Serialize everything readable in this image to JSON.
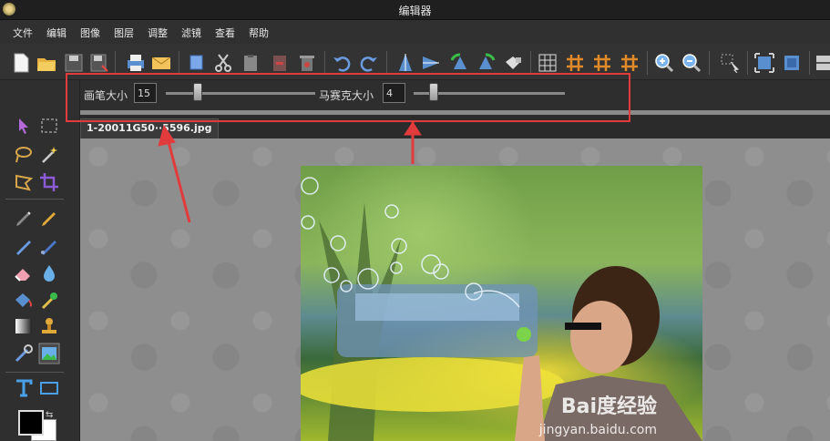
{
  "window": {
    "title": "编辑器"
  },
  "menu": [
    "文件",
    "编辑",
    "图像",
    "图层",
    "调整",
    "滤镜",
    "查看",
    "帮助"
  ],
  "toolbar_icons": [
    "new-file-icon",
    "open-folder-icon",
    "save-icon",
    "save-as-icon",
    "print-icon",
    "email-icon",
    "copy-icon",
    "cut-icon",
    "paste-icon",
    "delete-icon",
    "trash-icon",
    "undo-icon",
    "redo-icon",
    "flip-vertical-icon",
    "flip-horizontal-icon",
    "rotate-left-icon",
    "rotate-right-icon",
    "bucket-icon",
    "grid-icon",
    "hash-icon-1",
    "hash-icon-2",
    "hash-icon-3",
    "zoom-in-icon",
    "zoom-out-icon",
    "pointer-icon",
    "crop-fit-icon",
    "crop-full-icon",
    "panel-icon"
  ],
  "options": {
    "brush_size_label": "画笔大小",
    "brush_size_value": "15",
    "brush_slider_fraction": 0.18,
    "mosaic_size_label": "马赛克大小",
    "mosaic_size_value": "4",
    "mosaic_slider_fraction": 0.1
  },
  "document_tab": {
    "label": "1-20011G50··5596.jpg"
  },
  "tools": [
    "select-arrow-icon",
    "marquee-select-icon",
    "lasso-icon",
    "magic-wand-icon",
    "polygon-lasso-icon",
    "crop-icon",
    "pencil-icon",
    "pen-icon",
    "brush-icon",
    "smudge-icon",
    "eraser-icon",
    "blur-icon",
    "fill-bucket-icon",
    "color-picker-icon",
    "gradient-icon",
    "stamp-icon",
    "mosaic-brush-icon",
    "image-icon",
    "text-icon",
    "rectangle-icon"
  ],
  "colors": {
    "foreground": "#000000",
    "background": "#ffffff",
    "annotation": "#e23b3b"
  },
  "watermark": {
    "brand": "Bai度经验",
    "url": "jingyan.baidu.com"
  }
}
